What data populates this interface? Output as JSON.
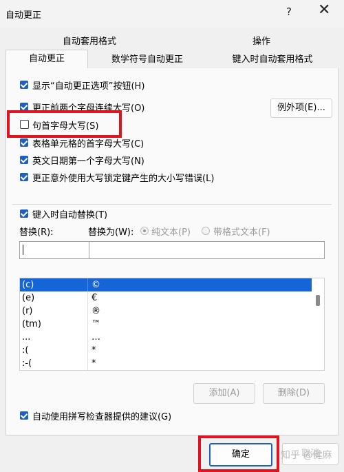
{
  "window": {
    "title": "自动更正",
    "help_icon": "?",
    "close_icon": "✕"
  },
  "tabs_top": [
    "自动套用格式",
    "操作"
  ],
  "tabs_bottom": [
    "自动更正",
    "数学符号自动更正",
    "键入时自动套用格式"
  ],
  "options": {
    "show_buttons": "显示“自动更正选项”按钮(H)",
    "two_initial_caps": "更正前两个字母连续大写(O)",
    "capitalize_sentences": "句首字母大写(S)",
    "capitalize_table_cells": "表格单元格的首字母大写(C)",
    "capitalize_day_names": "英文日期第一个字母大写(N)",
    "caps_lock": "更正意外使用大写锁定键产生的大小写错误(L)",
    "exceptions_button": "例外项(E)..."
  },
  "replace": {
    "enable_label": "键入时自动替换(T)",
    "replace_label": "替换(R):",
    "with_label": "替换为(W):",
    "plain_text": "纯文本(P)",
    "formatted_text": "带格式文本(F)",
    "replace_value": "",
    "with_value": "",
    "entries": [
      {
        "from": "(c)",
        "to": "©"
      },
      {
        "from": "(e)",
        "to": "€"
      },
      {
        "from": "(r)",
        "to": "®"
      },
      {
        "from": "(tm)",
        "to": "™"
      },
      {
        "from": "...",
        "to": "…"
      },
      {
        "from": ":(",
        "to": "*"
      },
      {
        "from": ":-(",
        "to": "*"
      }
    ],
    "add_button": "添加(A)",
    "delete_button": "删除(D)"
  },
  "spellcheck_option": "自动使用拼写检查器提供的建议(G)",
  "footer": {
    "ok_button": "确定",
    "cancel_button": "取消"
  },
  "watermark": "知乎 @健麻",
  "colors": {
    "accent": "#1f5fbf",
    "highlight": "#e0141e",
    "selected_row": "#1565d6"
  }
}
